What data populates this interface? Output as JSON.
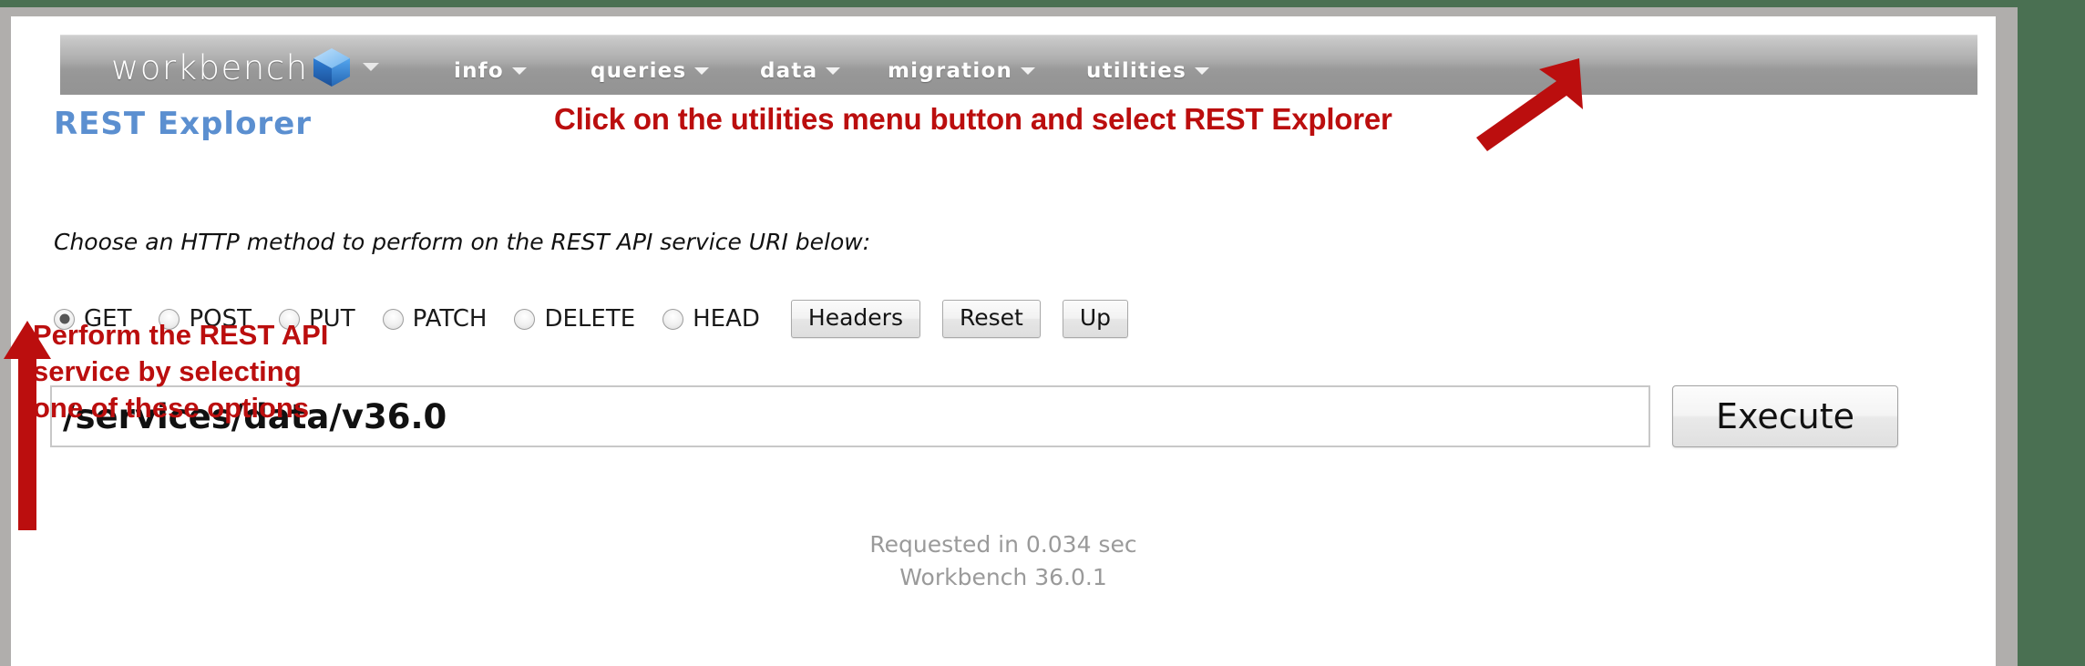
{
  "navbar": {
    "brand": "workbench",
    "brand_icon": "cube-icon",
    "brand_caret": "chevron-down-icon",
    "items": [
      {
        "label": "info",
        "caret": "chevron-down-icon"
      },
      {
        "label": "queries",
        "caret": "chevron-down-icon"
      },
      {
        "label": "data",
        "caret": "chevron-down-icon"
      },
      {
        "label": "migration",
        "caret": "chevron-down-icon"
      },
      {
        "label": "utilities",
        "caret": "chevron-down-icon"
      }
    ]
  },
  "page": {
    "title": "REST Explorer",
    "subtitle": "Choose an HTTP method to perform on the REST API service URI below:"
  },
  "methods": {
    "selected": "GET",
    "options": [
      {
        "label": "GET",
        "checked": true
      },
      {
        "label": "POST",
        "checked": false
      },
      {
        "label": "PUT",
        "checked": false
      },
      {
        "label": "PATCH",
        "checked": false
      },
      {
        "label": "DELETE",
        "checked": false
      },
      {
        "label": "HEAD",
        "checked": false
      }
    ],
    "buttons": [
      {
        "label": "Headers"
      },
      {
        "label": "Reset"
      },
      {
        "label": "Up"
      }
    ]
  },
  "uri": {
    "value": "/services/data/v36.0",
    "placeholder": "/services/data/v36.0",
    "execute_label": "Execute"
  },
  "status": {
    "requested": "Requested in 0.034 sec",
    "version": "Workbench 36.0.1"
  },
  "annotations": {
    "utilities_note": "Click on the utilities menu button and select REST Explorer",
    "methods_note_line1": "Perform the REST API",
    "methods_note_line2": "service by selecting",
    "methods_note_line3": "one of these options",
    "arrow_utilities": "arrow-up-right-icon",
    "arrow_methods": "arrow-up-icon"
  },
  "colors": {
    "accent_blue": "#5b8fd0",
    "annotation_red": "#bb0e0e",
    "navbar_gray": "#a0a0a0",
    "page_background": "#4a7052",
    "frame_gray": "#b0aeac"
  }
}
